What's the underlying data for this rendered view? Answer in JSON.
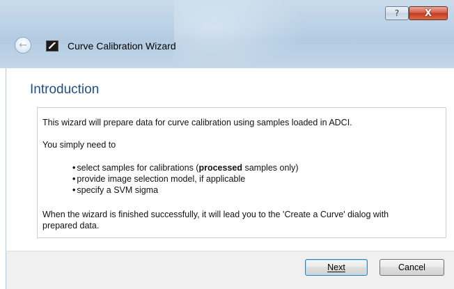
{
  "window": {
    "title": "Curve Calibration Wizard",
    "help_glyph": "?",
    "close_glyph": "X",
    "back_glyph": "←"
  },
  "page": {
    "heading": "Introduction"
  },
  "intro": {
    "line1": "This wizard will prepare data for curve calibration using samples loaded in ADCI.",
    "line2": "You simply need to",
    "bullets": [
      {
        "pre": "select samples for calibrations (",
        "bold": "processed",
        "post": " samples only)"
      },
      {
        "text": "provide image selection model, if applicable"
      },
      {
        "text": "specify a SVM sigma"
      }
    ],
    "closing_1": "When the wizard is finished successfully, it will lead you to the 'Create a Curve' dialog with",
    "closing_2": "prepared data."
  },
  "buttons": {
    "next": "Next",
    "cancel": "Cancel"
  },
  "colors": {
    "heading": "#1e4f8c",
    "close_button": "#c43c22",
    "frame": "#bcd2e6"
  }
}
